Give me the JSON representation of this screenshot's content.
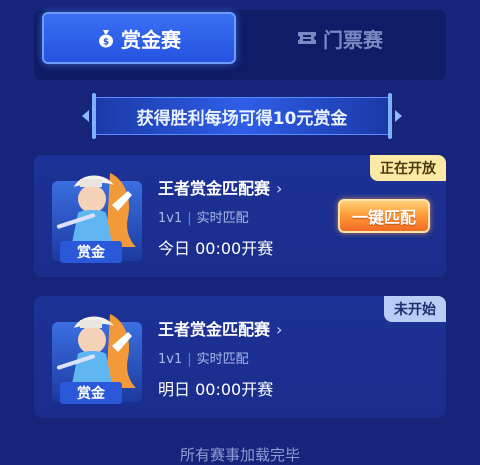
{
  "tabs": [
    {
      "label": "赏金赛",
      "icon": "money-bag-icon",
      "active": true
    },
    {
      "label": "门票赛",
      "icon": "ticket-icon",
      "active": false
    }
  ],
  "banner": {
    "text": "获得胜利每场可得10元赏金"
  },
  "matches": [
    {
      "status": "正在开放",
      "badge": "赏金",
      "title": "王者赏金匹配赛",
      "mode": "1v1",
      "match_type": "实时匹配",
      "start_time": "今日 00:00开赛",
      "action_label": "一键匹配"
    },
    {
      "status": "未开始",
      "badge": "赏金",
      "title": "王者赏金匹配赛",
      "mode": "1v1",
      "match_type": "实时匹配",
      "start_time": "明日 00:00开赛"
    }
  ],
  "footer": {
    "text": "所有赛事加载完毕"
  },
  "colors": {
    "background": "#16247a",
    "card": "#1d3296",
    "tab_active": "#3a6ff2",
    "status_live": "#fbe9a6",
    "status_wait": "#b7cdf5",
    "action": "#ff9c3a"
  }
}
